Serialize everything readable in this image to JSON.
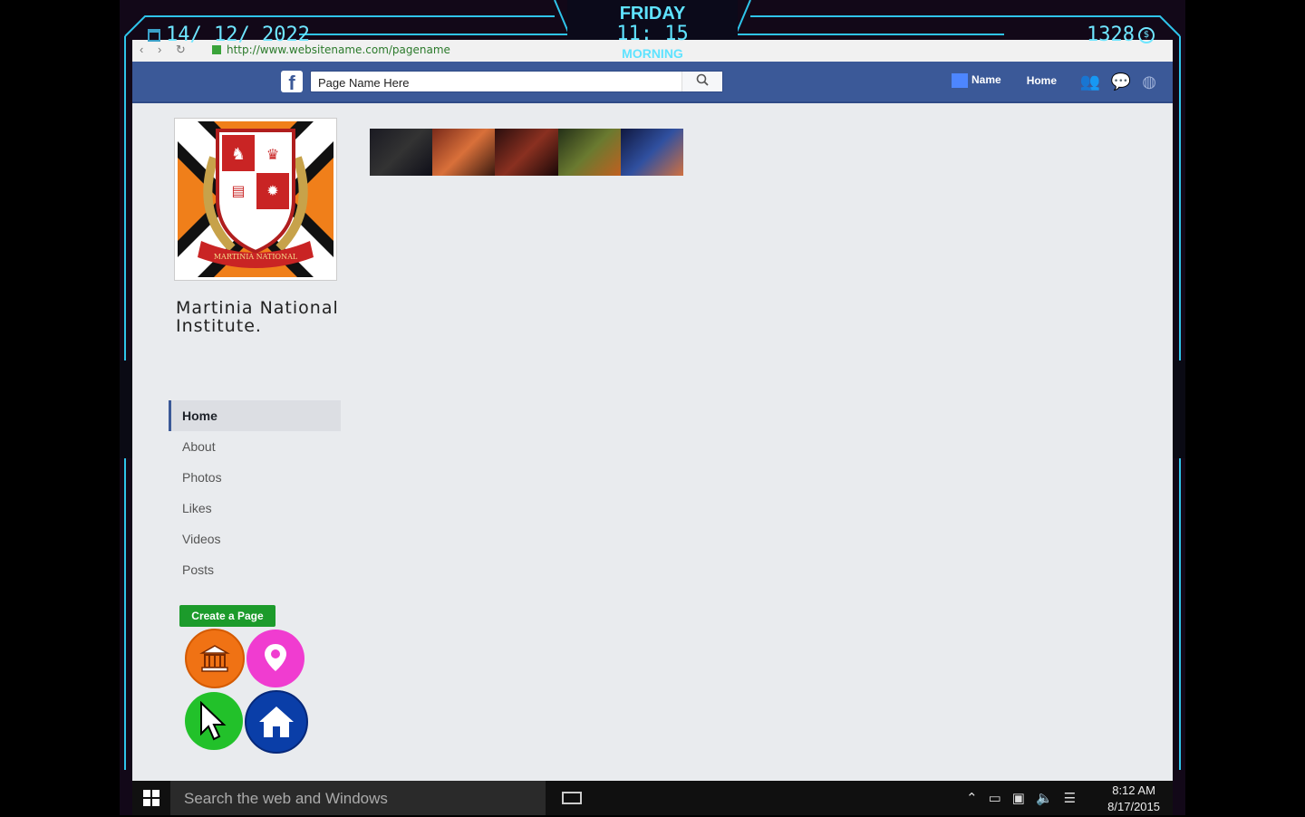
{
  "hud": {
    "date": "14/ 12/ 2022",
    "day": "FRIDAY",
    "time": "11: 15",
    "period": "MORNING",
    "coins": "1328",
    "coin_symbol": "$",
    "accent_color": "#3fd3ff"
  },
  "browser": {
    "url": "http://www.websitename.com/pagename"
  },
  "facebook": {
    "logo": "f",
    "search_placeholder": "Page Name Here",
    "search_value": "Page Name Here",
    "nav_name": "Name",
    "nav_home": "Home",
    "brand_color": "#3b5998"
  },
  "page": {
    "name_line1": "Martinia National",
    "name_line2": "Institute.",
    "crest_banner": "MARTINIA NATIONAL"
  },
  "sidebar": {
    "items": [
      {
        "label": "Home",
        "active": true
      },
      {
        "label": "About"
      },
      {
        "label": "Photos"
      },
      {
        "label": "Likes"
      },
      {
        "label": "Videos"
      },
      {
        "label": "Posts"
      }
    ]
  },
  "create_page_label": "Create a Page",
  "app_icons": [
    "bank-icon",
    "map-pin-icon",
    "cursor-app-icon",
    "home-icon"
  ],
  "taskbar": {
    "search_placeholder": "Search the web and Windows",
    "time": "8:12 AM",
    "date": "8/17/2015"
  }
}
